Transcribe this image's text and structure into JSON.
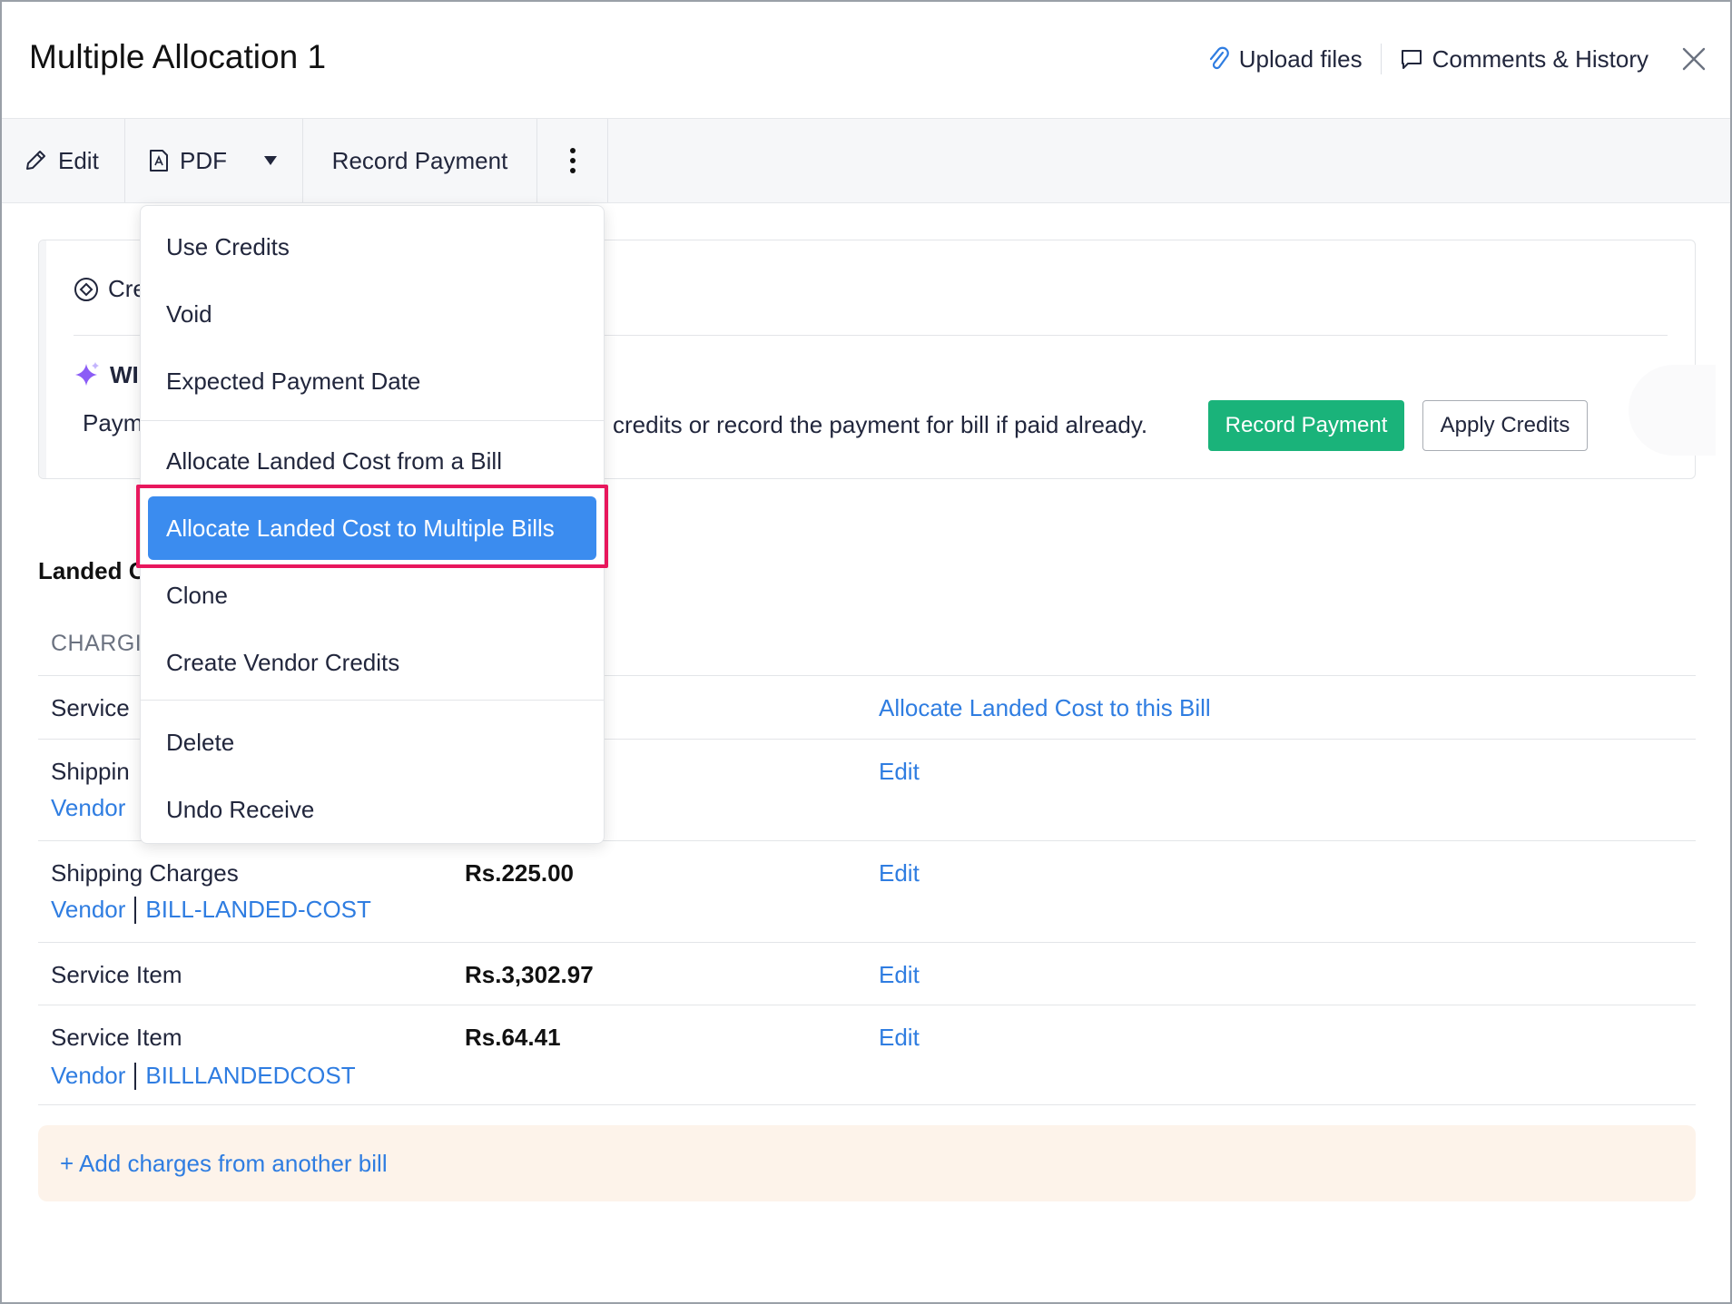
{
  "header": {
    "title": "Multiple Allocation 1",
    "upload_label": "Upload files",
    "comments_label": "Comments & History"
  },
  "toolbar": {
    "edit_label": "Edit",
    "pdf_label": "PDF",
    "record_payment_label": "Record Payment"
  },
  "card": {
    "head_partial": "Cre",
    "what_partial": "WI",
    "text_left_partial": "Paym",
    "text": "credits or record the payment for bill if paid already.",
    "record_payment_btn": "Record Payment",
    "apply_credits_btn": "Apply Credits"
  },
  "landed": {
    "title_partial": "Landed",
    "title_suffix": "C",
    "column_head_partial": "CHARGI",
    "rows": [
      {
        "name": "Service",
        "amount": "",
        "link": "Allocate Landed Cost to this Bill"
      },
      {
        "name": "Shippin",
        "vendor": "Vendor",
        "bill": "",
        "amount": "",
        "link": "Edit"
      },
      {
        "name": "Shipping Charges",
        "vendor": "Vendor",
        "bill": "BILL-LANDED-COST",
        "amount": "Rs.225.00",
        "link": "Edit"
      },
      {
        "name": "Service Item",
        "amount": "Rs.3,302.97",
        "link": "Edit"
      },
      {
        "name": "Service Item",
        "vendor": "Vendor",
        "bill": "BILLLANDEDCOST",
        "amount": "Rs.64.41",
        "link": "Edit"
      }
    ],
    "add_charges": "+ Add charges from another bill"
  },
  "menu": {
    "items": [
      "Use Credits",
      "Void",
      "Expected Payment Date",
      "Allocate Landed Cost from a Bill",
      "Allocate Landed Cost to Multiple Bills",
      "Clone",
      "Create Vendor Credits",
      "Delete",
      "Undo Receive"
    ]
  },
  "colors": {
    "accent_blue": "#2f7de1",
    "menu_active": "#3b8cef",
    "green": "#1ab37a",
    "highlight": "#e8175d",
    "add_bar_bg": "#fdf3ea"
  }
}
